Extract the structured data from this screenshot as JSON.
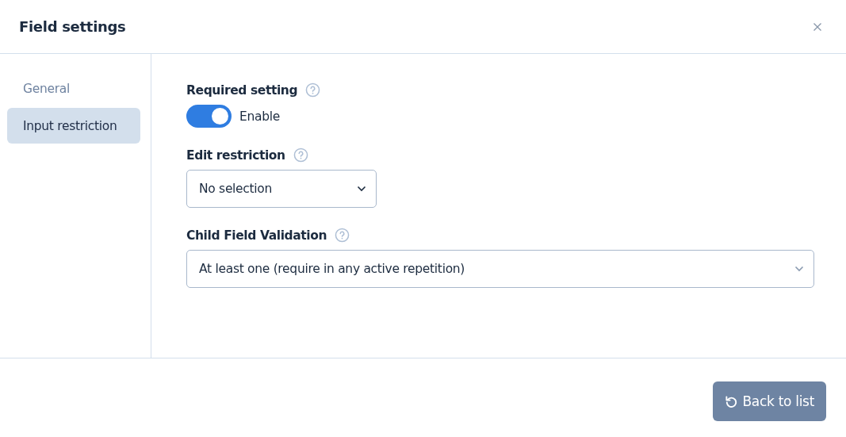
{
  "dialog": {
    "title": "Field settings"
  },
  "sidebar": {
    "items": [
      {
        "label": "General",
        "selected": false
      },
      {
        "label": "Input restriction",
        "selected": true
      }
    ]
  },
  "settings": [
    {
      "kind": "toggle",
      "label": "Required setting",
      "on": true,
      "toggle_label": "Enable"
    },
    {
      "kind": "select",
      "label": "Edit restriction",
      "value": "No selection",
      "wide": false
    },
    {
      "kind": "select",
      "label": "Child Field Validation",
      "value": "At least one (require in any active repetition)",
      "wide": true
    }
  ],
  "footer": {
    "button": "Back to list"
  }
}
